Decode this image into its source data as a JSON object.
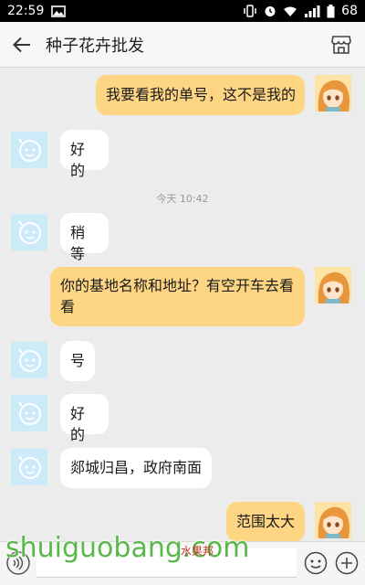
{
  "status_bar": {
    "time": "22:59",
    "battery": "68",
    "icons": [
      "image-icon",
      "vibrate-icon",
      "alarm-icon",
      "wifi-icon",
      "signal-icon",
      "battery-icon"
    ]
  },
  "header": {
    "title": "种子花卉批发",
    "back_icon": "arrow-left-icon",
    "store_icon": "store-icon"
  },
  "messages": [
    {
      "side": "out",
      "text": "我要看我的单号，这不是我的"
    },
    {
      "side": "in",
      "text": "好的"
    },
    {
      "side": "time",
      "text": "今天 10:42"
    },
    {
      "side": "in",
      "text": "稍等"
    },
    {
      "side": "out",
      "text": "你的基地名称和地址？有空开车去看看"
    },
    {
      "side": "in",
      "text": "号"
    },
    {
      "side": "in",
      "text": "好的"
    },
    {
      "side": "in",
      "text": "郯城归昌，政府南面"
    },
    {
      "side": "out",
      "text": "范围太大"
    }
  ],
  "input_bar": {
    "value": "",
    "icons": [
      "voice-icon",
      "emoji-icon",
      "plus-icon"
    ]
  },
  "watermark": {
    "text": "shuiguobang.com",
    "text_cn": "水果邦"
  },
  "colors": {
    "outgoing_bubble": "#fed683",
    "incoming_bubble": "#ffffff",
    "background": "#ececec",
    "incoming_avatar": "#cdeaf8"
  }
}
